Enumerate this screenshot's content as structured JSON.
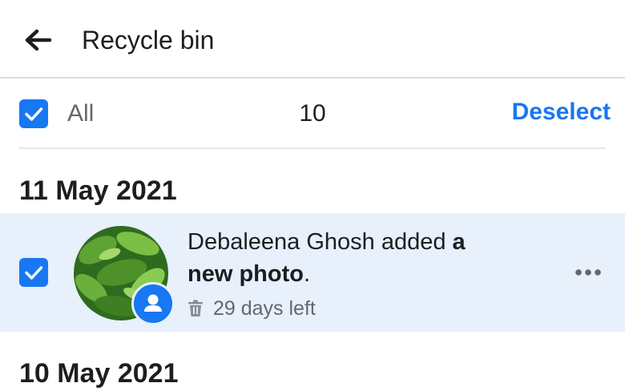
{
  "header": {
    "title": "Recycle bin"
  },
  "selection": {
    "all_label": "All",
    "count": "10",
    "deselect_label": "Deselect"
  },
  "groups": [
    {
      "date": "11 May 2021",
      "item": {
        "text_plain": "Debaleena Ghosh added ",
        "text_bold_1": "a",
        "text_bold_2": "new photo",
        "text_end": ".",
        "meta": "29 days left"
      }
    },
    {
      "date": "10 May 2021"
    }
  ],
  "colors": {
    "accent": "#1877f2",
    "selected_row": "#e7f0fb",
    "secondary_text": "#65676b"
  },
  "icons": [
    "back-arrow-icon",
    "checkbox-checked-icon",
    "profile-badge-icon",
    "trash-icon",
    "more-options-icon"
  ]
}
